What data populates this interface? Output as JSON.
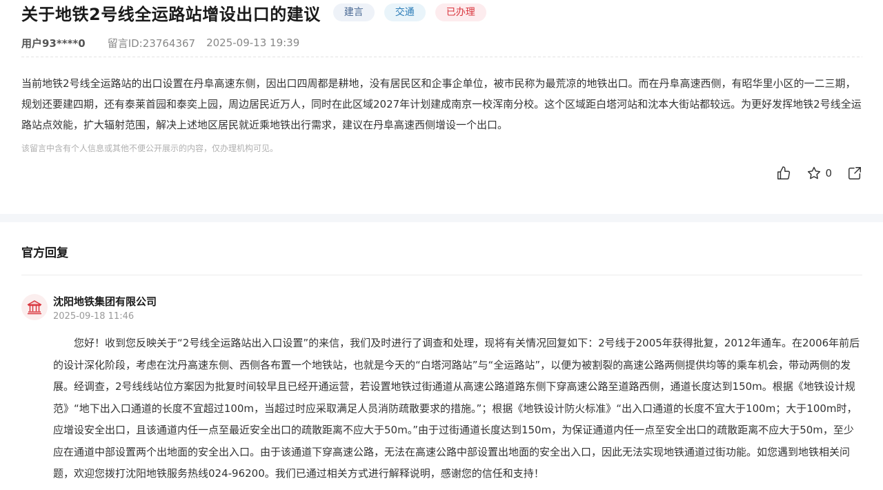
{
  "post": {
    "title": "关于地铁2号线全运路站增设出口的建议",
    "tags": [
      "建言",
      "交通",
      "已办理"
    ],
    "user": "用户93****0",
    "message_id": "留言ID:23764367",
    "datetime": "2025-09-13 19:39",
    "content": "当前地铁2号线全运路站的出口设置在丹阜高速东侧，因出口四周都是耕地，没有居民区和企事企单位，被市民称为最荒凉的地铁出口。而在丹阜高速西侧，有昭华里小区的一二三期，规划还要建四期，还有泰莱首园和泰奕上园，周边居民近万人，同时在此区域2027年计划建成南京一校浑南分校。这个区域距白塔河站和沈本大街站都较远。为更好发挥地铁2号线全运路站点效能，扩大辐射范围，解决上述地区居民就近乘地铁出行需求，建议在丹阜高速西侧增设一个出口。",
    "privacy_note": "该留言中含有个人信息或其他不便公开展示的内容，仅办理机构可见。",
    "favorite_count": "0",
    "icons": {
      "like": "thumbs-up-icon",
      "favorite": "star-icon",
      "share": "share-icon"
    }
  },
  "reply": {
    "section_title": "官方回复",
    "org_name": "沈阳地铁集团有限公司",
    "datetime": "2025-09-18 11:46",
    "avatar_icon": "government-building-icon",
    "content": "您好！收到您反映关于“2号线全运路站出入口设置”的来信，我们及时进行了调查和处理，现将有关情况回复如下：2号线于2005年获得批复，2012年通车。在2006年前后的设计深化阶段，考虑在沈丹高速东侧、西侧各布置一个地铁站，也就是今天的“白塔河路站”与“全运路站”，以便为被割裂的高速公路两侧提供均等的乘车机会，带动两侧的发展。经调查，2号线线站位方案因为批复时间较早且已经开通运营，若设置地铁过街通道从高速公路道路东侧下穿高速公路至道路西侧，通道长度达到150m。根据《地铁设计规范》“地下出入口通道的长度不宜超过100m，当超过时应采取满足人员消防疏散要求的措施。”；根据《地铁设计防火标准》“出入口通道的长度不宜大于100m；大于100m时，应增设安全出口，且该通道内任一点至最近安全出口的疏散距离不应大于50m。”由于过街通道长度达到150m，为保证通道内任一点至安全出口的疏散距离不应大于50m，至少应在通道中部设置两个出地面的安全出入口。由于该通道下穿高速公路，无法在高速公路中部设置出地面的安全出入口，因此无法实现地铁通道过街功能。如您遇到地铁相关问题，欢迎您拨打沈阳地铁服务热线024-96200。我们已通过相关方式进行解释说明，感谢您的信任和支持！"
  },
  "colors": {
    "tag_suggestion": "#4b6a94",
    "tag_traffic": "#2d7db8",
    "tag_done": "#d9363e",
    "avatar_bg": "#fbeeee",
    "avatar_icon": "#d9363e"
  }
}
